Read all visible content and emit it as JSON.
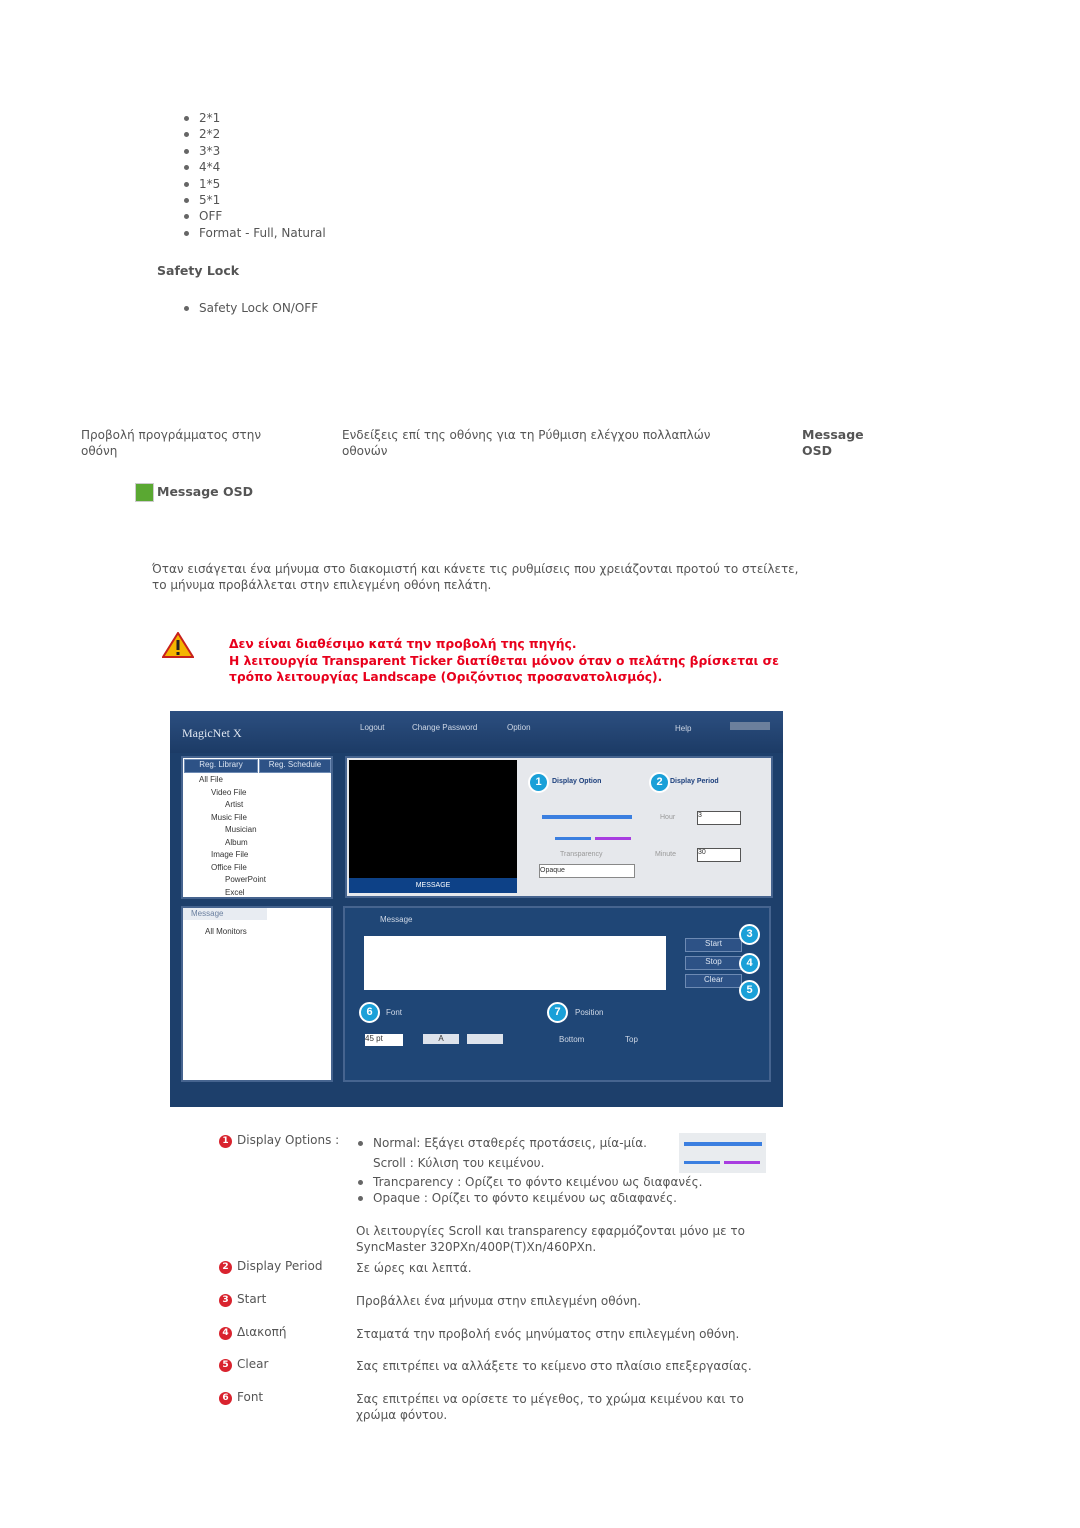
{
  "layout_options": [
    "2*1",
    "2*2",
    "3*3",
    "4*4",
    "1*5",
    "5*1",
    "OFF",
    "Format - Full, Natural"
  ],
  "safety_lock": {
    "heading": "Safety Lock",
    "items": [
      "Safety Lock ON/OFF"
    ]
  },
  "nav": {
    "left": "Προβολή προγράμματος στην οθόνη",
    "middle": "Ενδείξεις επί της οθόνης για τη Ρύθμιση ελέγχου πολλαπλών οθονών",
    "current": "Message OSD"
  },
  "section": {
    "title": "Message OSD",
    "intro": "Όταν εισάγεται ένα μήνυμα στο διακομιστή και κάνετε τις ρυθμίσεις που χρειάζονται προτού το στείλετε, το μήνυμα προβάλλεται στην επιλεγμένη οθόνη πελάτη."
  },
  "warning": {
    "line1": "Δεν είναι διαθέσιμο κατά την προβολή της πηγής.",
    "line2": "Η λειτουργία Transparent Ticker διατίθεται μόνον όταν ο πελάτης βρίσκεται σε τρόπο λειτουργίας Landscape (Οριζόντιος προσανατολισμός)."
  },
  "app": {
    "logo": "MagicNet X",
    "menu": [
      "Logout",
      "Change Password",
      "Option"
    ],
    "help": "Help",
    "tabs": [
      "Reg. Library",
      "Reg. Schedule"
    ],
    "tree": [
      "All File",
      "Video File",
      "Artist",
      "Music File",
      "Musician",
      "Album",
      "Image File",
      "Office File",
      "PowerPoint",
      "Excel"
    ],
    "preview_label": "MESSAGE",
    "display_option": "Display Option",
    "transparency": "Transparency",
    "transparency_value": "Opaque",
    "display_period": "Display Period",
    "hour_label": "Hour",
    "hour_value": "3",
    "minute_label": "Minute",
    "minute_value": "30",
    "message_group": "Message",
    "monitor": "All Monitors",
    "message_tab": "Message",
    "start": "Start",
    "stop": "Stop",
    "clear": "Clear",
    "font_tab": "Font",
    "font_size": "45 pt",
    "font_color": "A",
    "position_tab": "Position",
    "bottom": "Bottom",
    "top": "Top",
    "callouts": [
      "1",
      "2",
      "3",
      "4",
      "5",
      "6",
      "7"
    ]
  },
  "legend": [
    {
      "n": "1",
      "label": "Display Options :"
    },
    {
      "n": "2",
      "label": "Display Period",
      "desc": "Σε ώρες και λεπτά."
    },
    {
      "n": "3",
      "label": "Start",
      "desc": "Προβάλλει ένα μήνυμα στην επιλεγμένη οθόνη."
    },
    {
      "n": "4",
      "label": "Διακοπή",
      "desc": "Σταματά την προβολή ενός μηνύματος στην επιλεγμένη οθόνη."
    },
    {
      "n": "5",
      "label": "Clear",
      "desc": "Σας επιτρέπει να αλλάξετε το κείμενο στο πλαίσιο επεξεργασίας."
    },
    {
      "n": "6",
      "label": "Font",
      "desc": "Σας επιτρέπει να ορίσετε το μέγεθος, το χρώμα κειμένου και το χρώμα φόντου."
    }
  ],
  "display_options": {
    "normal": "Normal: Εξάγει σταθερές προτάσεις, μία-μία.",
    "scroll": "Scroll : Κύλιση του κειμένου.",
    "transparency": "Trancparency : Ορίζει το φόντο κειμένου ως διαφανές.",
    "opaque": "Opaque : Ορίζει το φόντο κειμένου ως αδιαφανές.",
    "note": "Οι λειτουργίες Scroll και transparency εφαρμόζονται μόνο με το SyncMaster 320PXn/400P(T)Xn/460PXn."
  }
}
